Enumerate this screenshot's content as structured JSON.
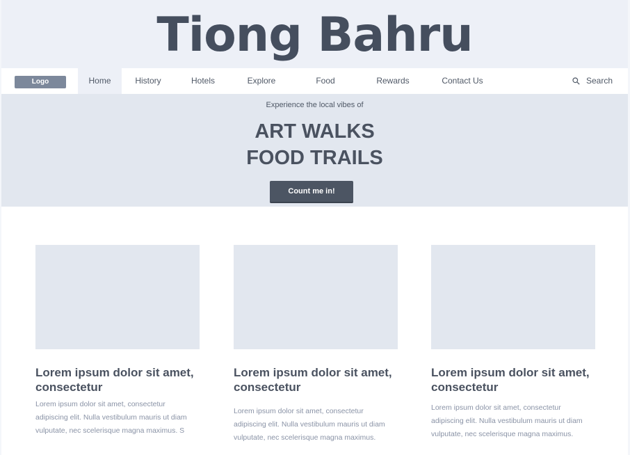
{
  "site": {
    "title": "Tiong Bahru"
  },
  "nav": {
    "logo_label": "Logo",
    "items": [
      {
        "label": "Home",
        "active": true
      },
      {
        "label": "History",
        "active": false
      },
      {
        "label": "Hotels",
        "active": false
      },
      {
        "label": "Explore",
        "active": false
      },
      {
        "label": "Food",
        "active": false
      },
      {
        "label": "Rewards",
        "active": false
      },
      {
        "label": "Contact Us",
        "active": false
      }
    ],
    "search_label": "Search",
    "search_icon": "search-icon"
  },
  "hero": {
    "kicker": "Experience the local vibes of",
    "line1": "ART WALKS",
    "line2": "FOOD TRAILS",
    "cta_label": "Count me in!"
  },
  "cards": [
    {
      "title": "Lorem ipsum dolor sit amet, consectetur",
      "text": "Lorem ipsum dolor sit amet, consectetur adipiscing elit. Nulla vestibulum mauris ut diam vulputate, nec scelerisque magna maximus. S"
    },
    {
      "title": "Lorem ipsum dolor sit amet, consectetur",
      "text": "Lorem ipsum dolor sit amet, consectetur adipiscing elit. Nulla vestibulum mauris ut diam vulputate, nec scelerisque magna maximus."
    },
    {
      "title": "Lorem ipsum dolor sit amet, consectetur",
      "text": "Lorem ipsum dolor sit amet, consectetur adipiscing elit. Nulla vestibulum mauris ut diam vulputate, nec scelerisque magna maximus."
    }
  ],
  "colors": {
    "title_band": "#edf0f7",
    "hero_bg": "#e2e7ef",
    "button_bg": "#4c5563",
    "logo_bg": "#7c889b",
    "text_dark": "#4a5260",
    "text_muted": "#8a93a6"
  }
}
